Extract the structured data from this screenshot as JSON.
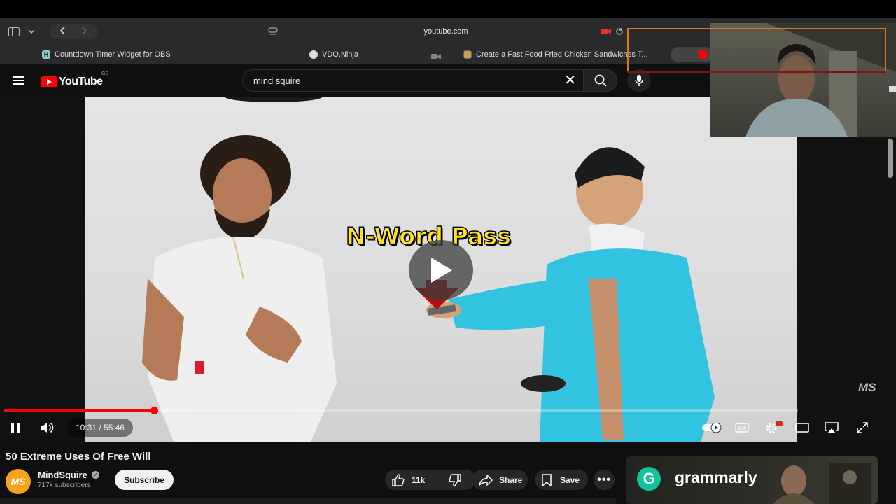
{
  "browser": {
    "url": "youtube.com",
    "tabs": [
      {
        "label": "Countdown Timer Widget for OBS",
        "favicon": "H"
      },
      {
        "label": "VDO.Ninja",
        "favicon": "ninja-icon"
      },
      {
        "label": "Create a Fast Food Fried Chicken Sandwiches T...",
        "favicon": "doc-icon"
      }
    ]
  },
  "header": {
    "logo": "YouTube",
    "region": "GB",
    "search_value": "mind squire"
  },
  "video": {
    "overlay_text": "N-Word Pass",
    "watermark": "MS",
    "time": "10:31 / 55:46",
    "progress": 0.189
  },
  "below": {
    "title": "50 Extreme Uses Of Free Will",
    "channel": "MindSquire",
    "channel_avatar_text": "MS",
    "subscribers": "717k subscribers",
    "subscribe_label": "Subscribe",
    "likes": "11k",
    "share_label": "Share",
    "save_label": "Save"
  },
  "ad": {
    "brand": "grammarly",
    "logo_letter": "G"
  },
  "colors": {
    "brand_red": "#ff0000",
    "grammarly_green": "#15c39a",
    "overlay_yellow": "#ffe21a"
  }
}
